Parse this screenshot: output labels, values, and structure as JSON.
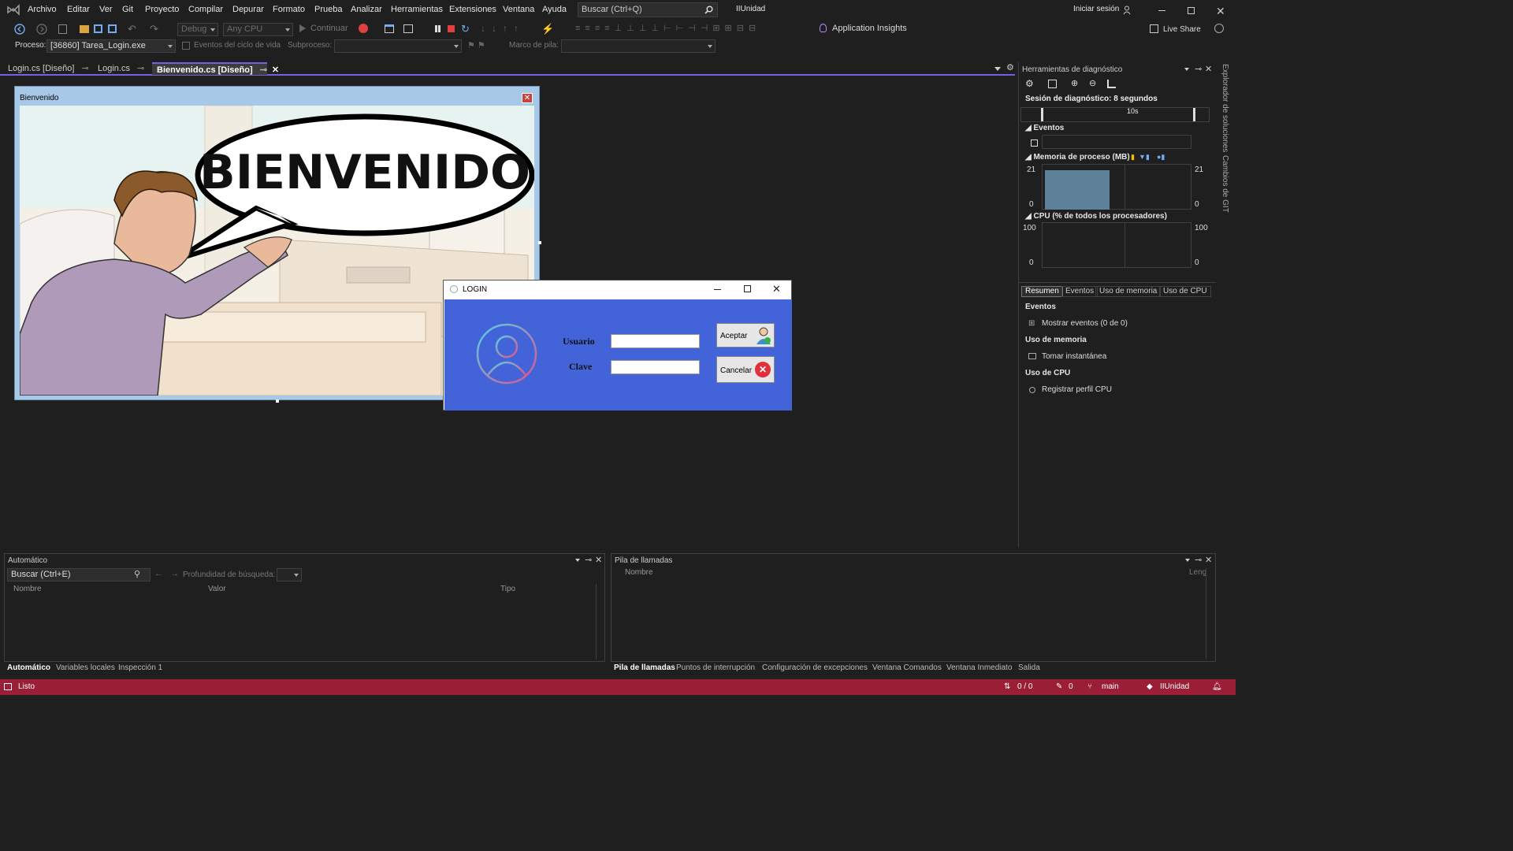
{
  "menu": [
    "Archivo",
    "Editar",
    "Ver",
    "Git",
    "Proyecto",
    "Compilar",
    "Depurar",
    "Formato",
    "Prueba",
    "Analizar",
    "Herramientas",
    "Extensiones",
    "Ventana",
    "Ayuda"
  ],
  "search": {
    "placeholder": "Buscar (Ctrl+Q)"
  },
  "solution_name": "IIUnidad",
  "signin": "Iniciar sesión",
  "toolbar": {
    "config": "Debug",
    "platform": "Any CPU",
    "continue": "Continuar",
    "insights": "Application Insights",
    "liveshare": "Live Share"
  },
  "debugbar": {
    "process_label": "Proceso:",
    "process_value": "[36860] Tarea_Login.exe",
    "lifecycle": "Eventos del ciclo de vida",
    "thread_label": "Subproceso:",
    "stack_label": "Marco de pila:"
  },
  "tabs": [
    {
      "label": "Login.cs [Diseño]"
    },
    {
      "label": "Login.cs"
    },
    {
      "label": "Bienvenido.cs [Diseño]"
    }
  ],
  "bienvenido": {
    "title": "Bienvenido",
    "speech": "BIENVENIDO"
  },
  "login": {
    "title": "LOGIN",
    "user_label": "Usuario",
    "pass_label": "Clave",
    "user_value": "",
    "pass_value": "",
    "accept": "Aceptar",
    "cancel": "Cancelar"
  },
  "diag": {
    "title": "Herramientas de diagnóstico",
    "session": "Sesión de diagnóstico: 8 segundos",
    "timeline_mark": "10s",
    "events": "Eventos",
    "memory": "Memoria de proceso (MB)",
    "mem_max": "21",
    "mem_min": "0",
    "cpu": "CPU (% de todos los procesadores)",
    "cpu_max": "100",
    "cpu_min": "0",
    "rtabs": [
      "Resumen",
      "Eventos",
      "Uso de memoria",
      "Uso de CPU"
    ],
    "sec_events": "Eventos",
    "show_events": "Mostrar eventos (0 de 0)",
    "sec_memory": "Uso de memoria",
    "snapshot": "Tomar instantánea",
    "sec_cpu": "Uso de CPU",
    "cpu_profile": "Registrar perfil CPU"
  },
  "vtabs": [
    "Explorador de soluciones",
    "Cambios de GIT"
  ],
  "auto": {
    "title": "Automático",
    "search": "Buscar (Ctrl+E)",
    "depth": "Profundidad de búsqueda:",
    "cols": [
      "Nombre",
      "Valor",
      "Tipo"
    ]
  },
  "calls": {
    "title": "Pila de llamadas",
    "cols": [
      "Nombre",
      "Leng"
    ]
  },
  "bottom_tabs_left": [
    "Automático",
    "Variables locales",
    "Inspección 1"
  ],
  "bottom_tabs_right": [
    "Pila de llamadas",
    "Puntos de interrupción",
    "Configuración de excepciones",
    "Ventana Comandos",
    "Ventana Inmediato",
    "Salida"
  ],
  "status": {
    "ready": "Listo",
    "lines": "0 / 0",
    "edits": "0",
    "branch": "main",
    "repo": "IIUnidad"
  }
}
